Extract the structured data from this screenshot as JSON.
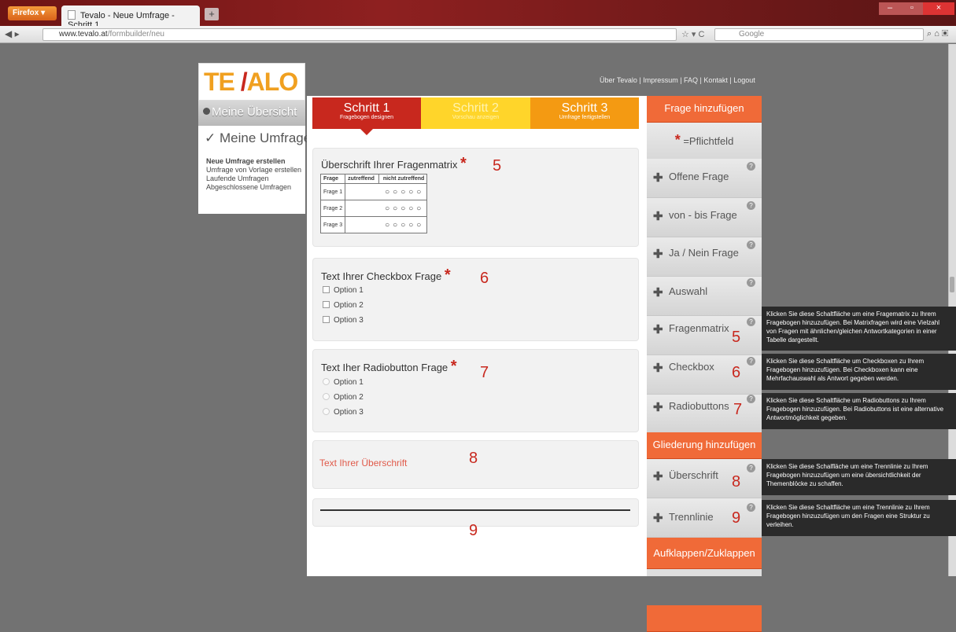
{
  "browser": {
    "app_button": "Firefox",
    "tab_title": "Tevalo - Neue Umfrage - Schritt 1",
    "new_tab": "+",
    "url_host": "www.tevalo.at",
    "url_path": "/formbuilder/neu",
    "search_placeholder": "Google"
  },
  "site": {
    "logo_left": "TE",
    "logo_mid": "/",
    "logo_right": "ALO",
    "top_links": "Über Tevalo | Impressum | FAQ | Kontakt | Logout"
  },
  "sidenav": {
    "overview": "Meine Übersicht",
    "surveys": "✓ Meine Umfragen",
    "links": [
      "Neue Umfrage erstellen",
      "Umfrage von Vorlage erstellen",
      "Laufende Umfragen",
      "Abgeschlossene Umfragen"
    ]
  },
  "steps": [
    {
      "title": "Schritt 1",
      "sub": "Fragebogen designen"
    },
    {
      "title": "Schritt 2",
      "sub": "Vorschau anzeigen"
    },
    {
      "title": "Schritt 3",
      "sub": "Umfrage fertigstellen"
    }
  ],
  "cards": {
    "matrix": {
      "title": "Überschrift Ihrer Fragenmatrix",
      "num": "5",
      "headers": [
        "Frage",
        "zutreffend",
        "nicht zutreffend"
      ],
      "rows": [
        "Frage 1",
        "Frage 2",
        "Frage 3"
      ],
      "radios": "○○○○○"
    },
    "checkbox": {
      "title": "Text Ihrer Checkbox Frage",
      "num": "6",
      "options": [
        "Option 1",
        "Option 2",
        "Option 3"
      ]
    },
    "radio": {
      "title": "Text Iher Radiobutton Frage",
      "num": "7",
      "options": [
        "Option 1",
        "Option 2",
        "Option 3"
      ]
    },
    "heading": {
      "title": "Text Ihrer Überschrift",
      "num": "8"
    },
    "divider": {
      "num": "9"
    }
  },
  "right": {
    "add_question": "Frage hinzufügen",
    "required": "=Pflichtfeld",
    "star": "*",
    "items": [
      "Offene Frage",
      "von - bis Frage",
      "Ja / Nein Frage",
      "Auswahl",
      "Fragenmatrix",
      "Checkbox",
      "Radiobuttons"
    ],
    "structure": "Gliederung hinzufügen",
    "struct_items": [
      "Überschrift",
      "Trennlinie"
    ],
    "collapse": "Aufklappen/Zuklappen",
    "item_nums": {
      "fragenmatrix": "5",
      "checkbox": "6",
      "radiobuttons": "7",
      "ueberschrift": "8",
      "trennlinie": "9"
    }
  },
  "tooltips": [
    "Klicken Sie diese Schaltfläche um eine Fragematrix zu Ihrem Fragebogen hinzuzufügen. Bei Matrixfragen wird eine Vielzahl von Fragen mit ähnlichen/gleichen Antwortkategorien in einer Tabelle dargestellt.",
    "Klicken Sie diese Schaltfläche um Checkboxen zu Ihrem Fragebogen hinzuzufügen. Bei Checkboxen kann eine Mehrfachauswahl als Antwort gegeben werden.",
    "Klicken Sie diese Schaltfläche um Radiobuttons zu Ihrem Fragebogen hinzuzufügen. Bei Radiobuttons ist eine alternative Antwortmöglichkeit gegeben.",
    "Klicken Sie diese Schalfläche um eine Trennlinie zu Ihrem Fragebogen hinzuzufügen um eine übersichtlichkeit der Themenblöcke zu schaffen.",
    "Klicken Sie diese Schaltfläche um eine Trennlinie zu Ihrem Fragebogen hinzuzufügen um den Fragen eine Struktur zu verleihen."
  ]
}
